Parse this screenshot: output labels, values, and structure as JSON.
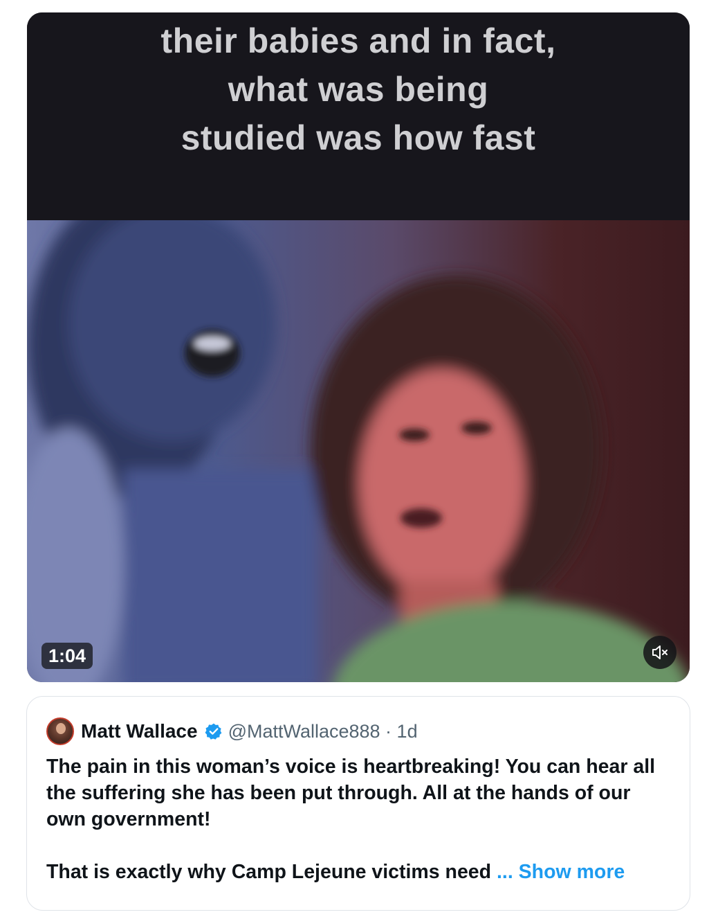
{
  "video": {
    "caption_lines": [
      "their babies and in fact,",
      "what was being",
      "studied was how fast"
    ],
    "duration": "1:04",
    "mute_icon": "speaker-muted-icon"
  },
  "quote_tweet": {
    "author_name": "Matt Wallace",
    "handle_time": "@MattWallace888 · 1d",
    "text_para1": "The pain in this woman’s voice is heartbreaking! You can hear all the suffering she has been put through. All at the hands of our own government!",
    "text_para2": "That is exactly why Camp Lejeune victims need",
    "ellipsis": " ... ",
    "show_more": "Show more",
    "verified_color": "#1d9bf0"
  }
}
